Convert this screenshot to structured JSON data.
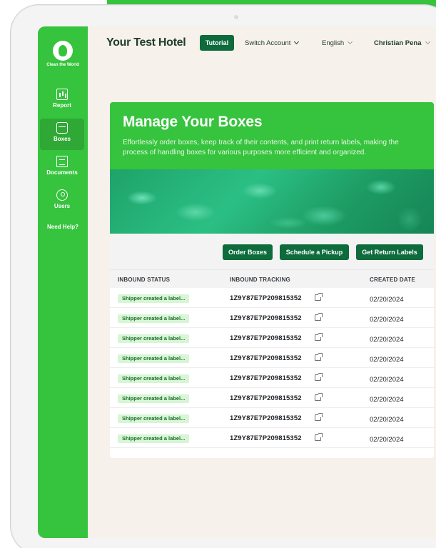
{
  "app": {
    "logo_text": "Clean the World",
    "hotel_name": "Your Test Hotel"
  },
  "header": {
    "tutorial_label": "Tutorial",
    "switch_account_label": "Switch Account",
    "language_label": "English",
    "user_name": "Christian Pena"
  },
  "sidebar": {
    "items": [
      {
        "label": "Report",
        "icon": "report-icon",
        "active": false
      },
      {
        "label": "Boxes",
        "icon": "box-icon",
        "active": true
      },
      {
        "label": "Documents",
        "icon": "documents-icon",
        "active": false
      },
      {
        "label": "Users",
        "icon": "user-icon",
        "active": false
      }
    ],
    "help_label": "Need Help?"
  },
  "hero": {
    "title": "Manage Your Boxes",
    "description": "Effortlessly order boxes, keep track of their contents, and print return labels, making the process of handling boxes for various purposes more efficient and organized."
  },
  "actions": {
    "order_boxes": "Order Boxes",
    "schedule_pickup": "Schedule a Pickup",
    "get_return_labels": "Get Return Labels"
  },
  "table": {
    "columns": [
      "INBOUND STATUS",
      "INBOUND TRACKING",
      "CREATED DATE"
    ],
    "rows": [
      {
        "status": "Shipper created a label...",
        "tracking": "1Z9Y87E7P209815352",
        "date": "02/20/2024"
      },
      {
        "status": "Shipper created a label...",
        "tracking": "1Z9Y87E7P209815352",
        "date": "02/20/2024"
      },
      {
        "status": "Shipper created a label...",
        "tracking": "1Z9Y87E7P209815352",
        "date": "02/20/2024"
      },
      {
        "status": "Shipper created a label...",
        "tracking": "1Z9Y87E7P209815352",
        "date": "02/20/2024"
      },
      {
        "status": "Shipper created a label...",
        "tracking": "1Z9Y87E7P209815352",
        "date": "02/20/2024"
      },
      {
        "status": "Shipper created a label...",
        "tracking": "1Z9Y87E7P209815352",
        "date": "02/20/2024"
      },
      {
        "status": "Shipper created a label...",
        "tracking": "1Z9Y87E7P209815352",
        "date": "02/20/2024"
      },
      {
        "status": "Shipper created a label...",
        "tracking": "1Z9Y87E7P209815352",
        "date": "02/20/2024"
      }
    ]
  },
  "colors": {
    "brand_green": "#36c33d",
    "dark_green": "#0d6b3c",
    "badge_bg": "#d8f5d6"
  }
}
